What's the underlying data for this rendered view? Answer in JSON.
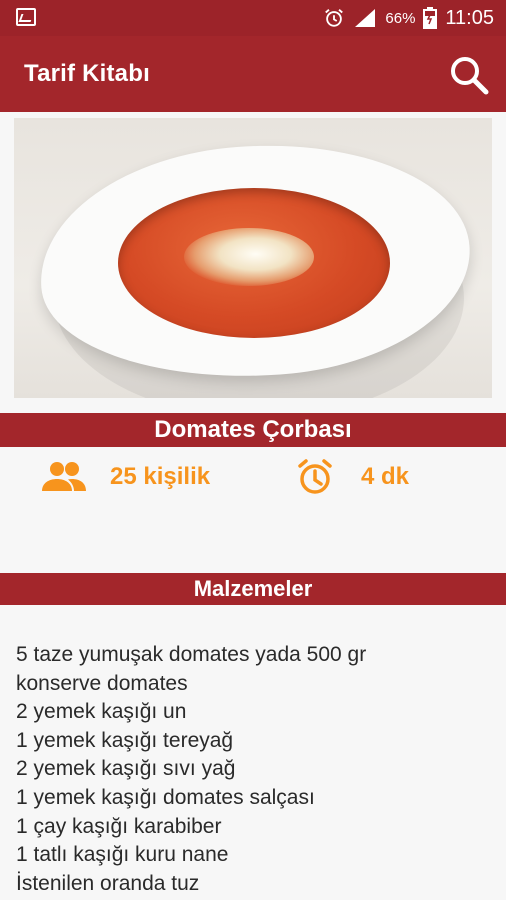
{
  "status_bar": {
    "battery_percent": "66%",
    "time": "11:05"
  },
  "app_bar": {
    "title": "Tarif Kitabı",
    "search_icon": "search-icon"
  },
  "recipe": {
    "image_icon": "soup-photo",
    "title": "Domates Çorbası",
    "servings": "25 kişilik",
    "duration": "4 dk"
  },
  "ingredients_section": {
    "heading": "Malzemeler",
    "lines": [
      "5 taze yumuşak domates yada 500 gr",
      "konserve domates",
      "2 yemek kaşığı un",
      "1 yemek kaşığı tereyağ",
      "2 yemek kaşığı sıvı yağ",
      "1 yemek kaşığı domates salçası",
      "1 çay kaşığı karabiber",
      "1 tatlı kaşığı kuru nane",
      "İstenilen oranda tuz"
    ]
  },
  "colors": {
    "primary": "#a3262b",
    "accent": "#f7941d"
  }
}
